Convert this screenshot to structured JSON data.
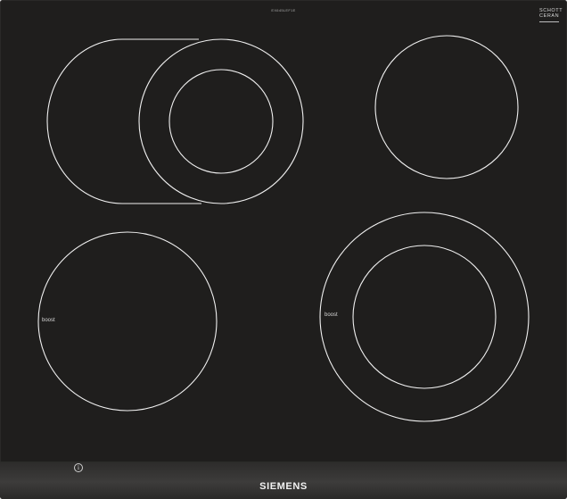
{
  "hob": {
    "top_label": "EX645LEF1E",
    "ceran_logo": {
      "line1": "SCHOTT",
      "line2": "CERAN"
    },
    "brand": "SIEMENS",
    "info_symbol": "i",
    "zones": [
      {
        "id": "front-left",
        "label": "boost"
      },
      {
        "id": "front-right",
        "label": "boost"
      }
    ]
  },
  "colors": {
    "glass": "#1f1e1d",
    "zone_outline": "#f0f0f0",
    "strip": "#3d3c3b"
  }
}
